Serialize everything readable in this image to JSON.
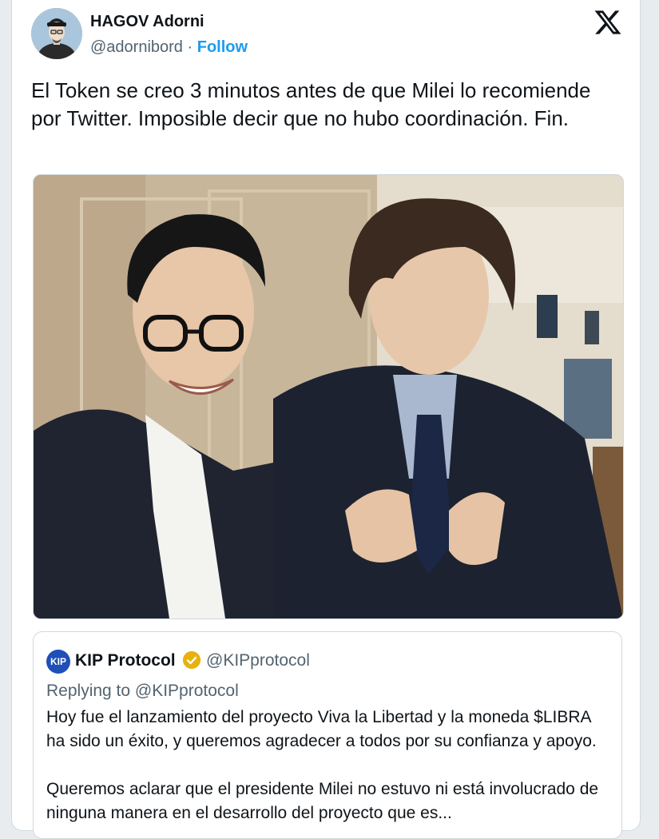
{
  "tweet": {
    "author_name": "HAGOV Adorni",
    "author_handle": "@adornibord",
    "separator": "·",
    "follow_label": "Follow",
    "platform_icon": "x-logo-icon",
    "text": "El Token se creo 3 minutos antes de que Milei lo recomiende por Twitter.  Imposible decir que no hubo coordinación. Fin."
  },
  "media": {
    "type": "photo",
    "icon": "photo-image"
  },
  "quoted_tweet": {
    "logo_text": "KIP",
    "author_name": "KIP Protocol",
    "verified_icon": "gold-verified-badge-icon",
    "author_handle": "@KIPprotocol",
    "replying_to": "Replying to @KIPprotocol",
    "text": "Hoy fue el lanzamiento del proyecto Viva la Libertad y la moneda $LIBRA ha sido un éxito, y queremos agradecer a todos por su confianza y apoyo.\n\nQueremos aclarar que el presidente Milei no estuvo ni está involucrado de ninguna manera en el desarrollo del proyecto que es..."
  },
  "colors": {
    "follow": "#1d9bf0",
    "secondary_text": "#536471",
    "primary_text": "#0f1419",
    "verified_badge": "#e8b10c"
  }
}
